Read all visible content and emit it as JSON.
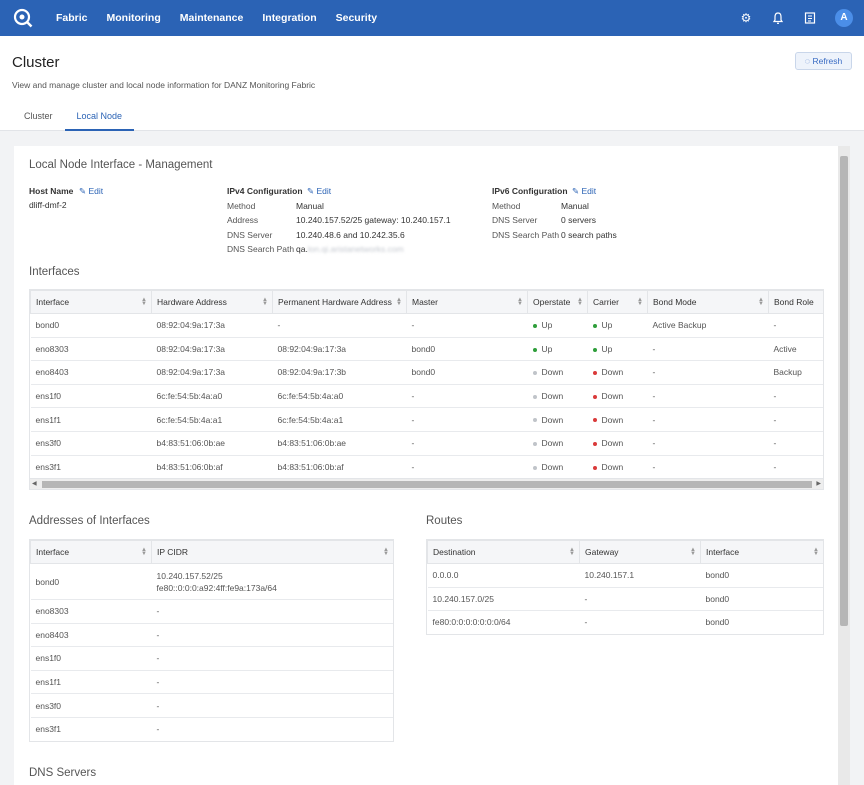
{
  "nav": {
    "items": [
      "Fabric",
      "Monitoring",
      "Maintenance",
      "Integration",
      "Security"
    ],
    "icons": [
      "settings-icon",
      "bell-icon",
      "docs-icon"
    ],
    "avatar": "A"
  },
  "page": {
    "title": "Cluster",
    "subtitle": "View and manage cluster and local node information for DANZ Monitoring Fabric",
    "refresh": "Refresh",
    "tabs": [
      "Cluster",
      "Local Node"
    ],
    "active_tab": "Local Node"
  },
  "mgmt": {
    "title": "Local Node Interface - Management",
    "edit": "Edit",
    "host": {
      "label": "Host Name",
      "value": "dliff-dmf-2"
    },
    "ipv4": {
      "label": "IPv4 Configuration",
      "rows": [
        {
          "k": "Method",
          "v": "Manual"
        },
        {
          "k": "Address",
          "v": "10.240.157.52/25 gateway: 10.240.157.1"
        },
        {
          "k": "DNS Server",
          "v": "10.240.48.6 and 10.242.35.6"
        },
        {
          "k": "DNS Search Path",
          "v": "qa."
        }
      ]
    },
    "ipv6": {
      "label": "IPv6 Configuration",
      "rows": [
        {
          "k": "Method",
          "v": "Manual"
        },
        {
          "k": "DNS Server",
          "v": "0 servers"
        },
        {
          "k": "DNS Search Path",
          "v": "0 search paths"
        }
      ]
    }
  },
  "interfaces": {
    "title": "Interfaces",
    "columns": [
      "Interface",
      "Hardware Address",
      "Permanent Hardware Address",
      "Master",
      "Operstate",
      "Carrier",
      "Bond Mode",
      "Bond Role"
    ],
    "rows": [
      {
        "iface": "bond0",
        "hw": "08:92:04:9a:17:3a",
        "perm": "-",
        "master": "-",
        "oper": "Up",
        "carrier": "Up",
        "mode": "Active Backup",
        "role": "-"
      },
      {
        "iface": "eno8303",
        "hw": "08:92:04:9a:17:3a",
        "perm": "08:92:04:9a:17:3a",
        "master": "bond0",
        "oper": "Up",
        "carrier": "Up",
        "mode": "-",
        "role": "Active"
      },
      {
        "iface": "eno8403",
        "hw": "08:92:04:9a:17:3a",
        "perm": "08:92:04:9a:17:3b",
        "master": "bond0",
        "oper": "Down",
        "carrier": "Down",
        "mode": "-",
        "role": "Backup"
      },
      {
        "iface": "ens1f0",
        "hw": "6c:fe:54:5b:4a:a0",
        "perm": "6c:fe:54:5b:4a:a0",
        "master": "-",
        "oper": "Down",
        "carrier": "Down",
        "mode": "-",
        "role": "-"
      },
      {
        "iface": "ens1f1",
        "hw": "6c:fe:54:5b:4a:a1",
        "perm": "6c:fe:54:5b:4a:a1",
        "master": "-",
        "oper": "Down",
        "carrier": "Down",
        "mode": "-",
        "role": "-"
      },
      {
        "iface": "ens3f0",
        "hw": "b4:83:51:06:0b:ae",
        "perm": "b4:83:51:06:0b:ae",
        "master": "-",
        "oper": "Down",
        "carrier": "Down",
        "mode": "-",
        "role": "-"
      },
      {
        "iface": "ens3f1",
        "hw": "b4:83:51:06:0b:af",
        "perm": "b4:83:51:06:0b:af",
        "master": "-",
        "oper": "Down",
        "carrier": "Down",
        "mode": "-",
        "role": "-"
      }
    ]
  },
  "addresses": {
    "title": "Addresses of Interfaces",
    "columns": [
      "Interface",
      "IP CIDR"
    ],
    "rows": [
      {
        "iface": "bond0",
        "cidr": [
          "10.240.157.52/25",
          "fe80::0:0:0:a92:4ff:fe9a:173a/64"
        ]
      },
      {
        "iface": "eno8303",
        "cidr": [
          "-"
        ]
      },
      {
        "iface": "eno8403",
        "cidr": [
          "-"
        ]
      },
      {
        "iface": "ens1f0",
        "cidr": [
          "-"
        ]
      },
      {
        "iface": "ens1f1",
        "cidr": [
          "-"
        ]
      },
      {
        "iface": "ens3f0",
        "cidr": [
          "-"
        ]
      },
      {
        "iface": "ens3f1",
        "cidr": [
          "-"
        ]
      }
    ]
  },
  "routes": {
    "title": "Routes",
    "columns": [
      "Destination",
      "Gateway",
      "Interface"
    ],
    "rows": [
      {
        "dest": "0.0.0.0",
        "gw": "10.240.157.1",
        "iface": "bond0"
      },
      {
        "dest": "10.240.157.0/25",
        "gw": "-",
        "iface": "bond0"
      },
      {
        "dest": "fe80:0:0:0:0:0:0:0/64",
        "gw": "-",
        "iface": "bond0"
      }
    ]
  },
  "dns": {
    "title": "DNS Servers"
  },
  "colors": {
    "brand": "#2b63b5",
    "up": "#2e9e3a",
    "down_oper": "#c0c4c9",
    "down_carrier": "#d93a3a"
  }
}
